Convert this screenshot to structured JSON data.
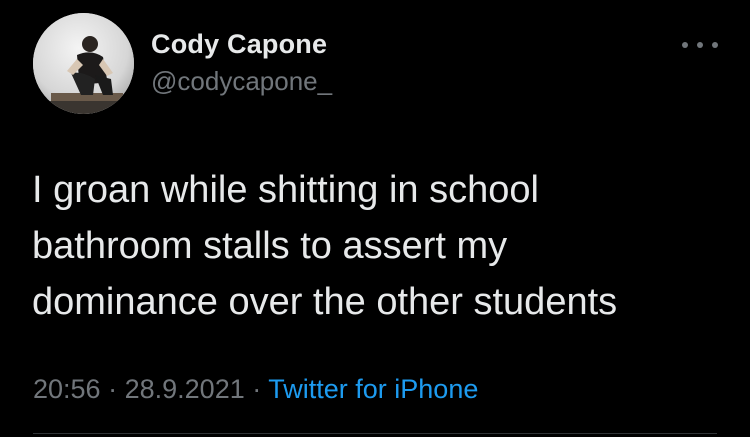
{
  "tweet": {
    "display_name": "Cody Capone",
    "handle": "@codycapone_",
    "text": "I groan while shitting in school\nbathroom stalls to assert my\ndominance over the other students",
    "time": "20:56",
    "separator": "·",
    "date": "28.9.2021",
    "source": "Twitter for iPhone"
  },
  "icons": {
    "more": "more-options-icon"
  },
  "colors": {
    "background": "#000000",
    "primary_text": "#e7e9ea",
    "secondary_text": "#71767b",
    "link": "#1d9bf0"
  }
}
